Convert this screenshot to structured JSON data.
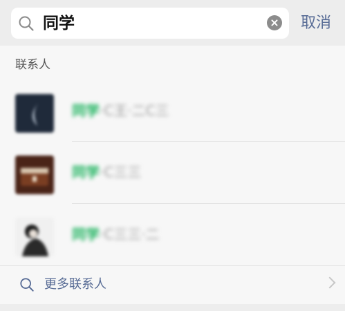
{
  "search": {
    "query": "同学",
    "cancel_label": "取消"
  },
  "section": {
    "title": "联系人"
  },
  "contacts": [
    {
      "highlight": "同学",
      "rest": "·C王·二C三"
    },
    {
      "highlight": "同学",
      "rest": "·C三三"
    },
    {
      "highlight": "同学",
      "rest": "·C三三·二"
    }
  ],
  "more": {
    "label": "更多联系人"
  },
  "colors": {
    "accent_link": "#576b95",
    "highlight_green": "#17b15a",
    "background": "#ededed"
  }
}
